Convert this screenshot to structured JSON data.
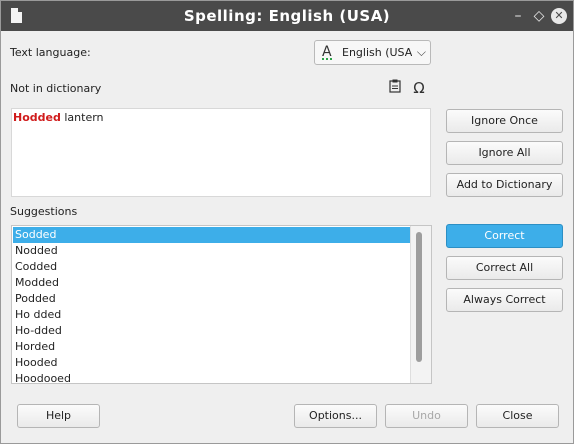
{
  "window": {
    "title": "Spelling: English (USA)",
    "controls": {
      "minimize": "–",
      "maximize": "◇",
      "close": "✕"
    }
  },
  "language": {
    "label_underlined": "Text language",
    "label_mnemonic_char": "g",
    "label": "Text language:",
    "value": "English (USA)",
    "icon": "A"
  },
  "not_in_dictionary": {
    "label": "Not in dictionary",
    "misspelled_word": "Hodded",
    "rest_text": " lantern",
    "paste_icon": "clipboard-icon",
    "special_char_icon": "Ω"
  },
  "suggestions": {
    "label": "Suggestions",
    "selected_index": 0,
    "items": [
      "Sodded",
      "Nodded",
      "Codded",
      "Modded",
      "Podded",
      "Ho dded",
      "Ho-dded",
      "Horded",
      "Hooded",
      "Hoodooed"
    ]
  },
  "right_buttons": {
    "ignore_once": "Ignore Once",
    "ignore_all": "Ignore All",
    "add_to_dictionary": "Add to Dictionary",
    "correct": "Correct",
    "correct_all": "Correct All",
    "always_correct": "Always Correct"
  },
  "bottom_buttons": {
    "help": "Help",
    "options": "Options...",
    "undo": "Undo",
    "close": "Close"
  },
  "colors": {
    "accent": "#3daee9",
    "titlebar": "#4a4a4a",
    "error": "#d01b1b"
  }
}
